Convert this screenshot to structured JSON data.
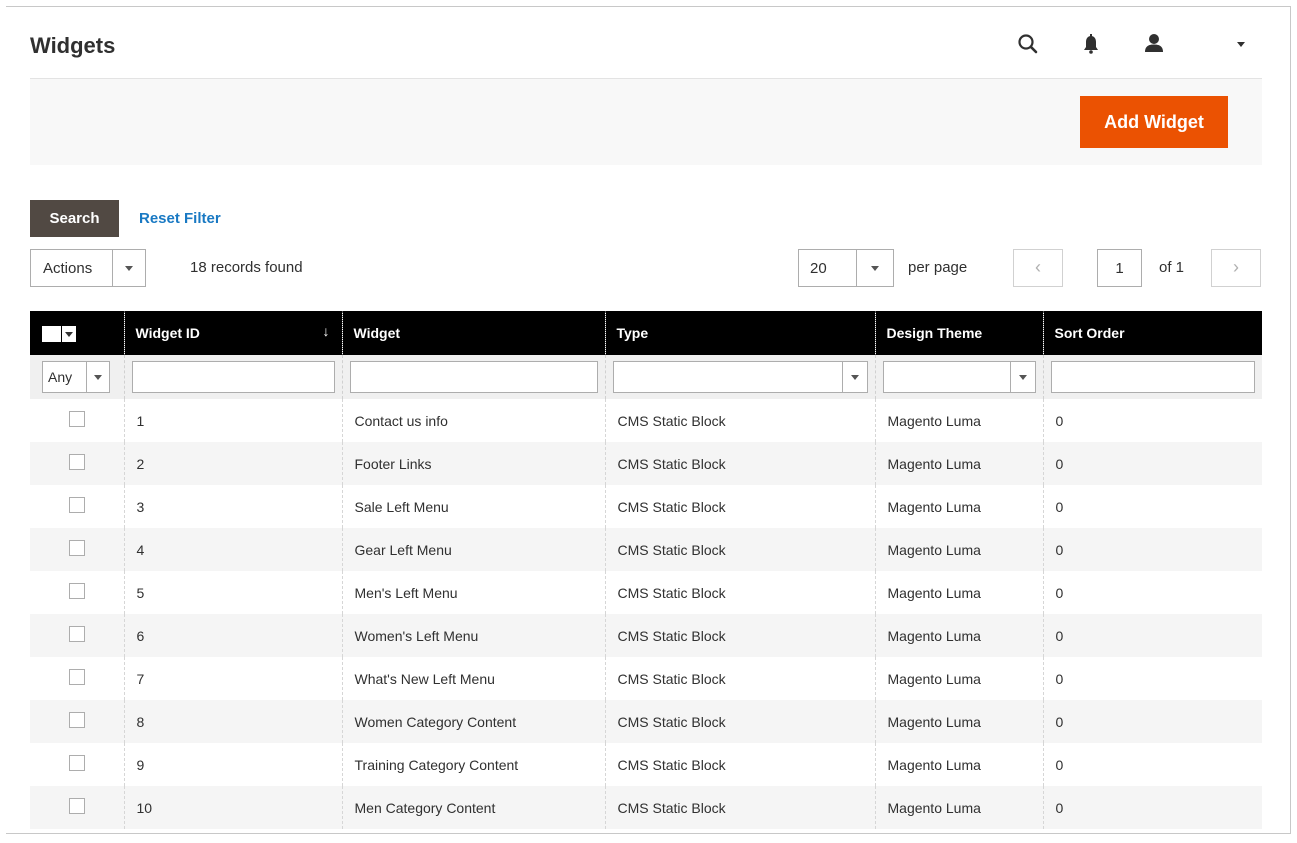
{
  "header": {
    "title": "Widgets",
    "icons": [
      "search-icon",
      "bell-icon",
      "user-icon",
      "chevron-down-icon"
    ]
  },
  "actionbar": {
    "add_label": "Add Widget"
  },
  "toolbar": {
    "search_label": "Search",
    "reset_label": "Reset Filter",
    "actions_label": "Actions",
    "records_text": "18 records found",
    "per_page_value": "20",
    "per_page_label": "per page",
    "page_value": "1",
    "of_total": "of 1",
    "prev_glyph": "‹",
    "next_glyph": "›"
  },
  "table": {
    "columns": [
      "Widget ID",
      "Widget",
      "Type",
      "Design Theme",
      "Sort Order"
    ],
    "sort_glyph": "↓",
    "filter_any": "Any",
    "rows": [
      {
        "id": "1",
        "widget": "Contact us info",
        "type": "CMS Static Block",
        "theme": "Magento Luma",
        "sort": "0"
      },
      {
        "id": "2",
        "widget": "Footer Links",
        "type": "CMS Static Block",
        "theme": "Magento Luma",
        "sort": "0"
      },
      {
        "id": "3",
        "widget": "Sale Left Menu",
        "type": "CMS Static Block",
        "theme": "Magento Luma",
        "sort": "0"
      },
      {
        "id": "4",
        "widget": "Gear Left Menu",
        "type": "CMS Static Block",
        "theme": "Magento Luma",
        "sort": "0"
      },
      {
        "id": "5",
        "widget": "Men's Left Menu",
        "type": "CMS Static Block",
        "theme": "Magento Luma",
        "sort": "0"
      },
      {
        "id": "6",
        "widget": "Women's Left Menu",
        "type": "CMS Static Block",
        "theme": "Magento Luma",
        "sort": "0"
      },
      {
        "id": "7",
        "widget": "What's New Left Menu",
        "type": "CMS Static Block",
        "theme": "Magento Luma",
        "sort": "0"
      },
      {
        "id": "8",
        "widget": "Women Category Content",
        "type": "CMS Static Block",
        "theme": "Magento Luma",
        "sort": "0"
      },
      {
        "id": "9",
        "widget": "Training Category Content",
        "type": "CMS Static Block",
        "theme": "Magento Luma",
        "sort": "0"
      },
      {
        "id": "10",
        "widget": "Men Category Content",
        "type": "CMS Static Block",
        "theme": "Magento Luma",
        "sort": "0"
      }
    ]
  },
  "colors": {
    "accent": "#eb5202",
    "search_btn": "#514943",
    "link": "#1979c3",
    "header_bg": "#000000"
  }
}
